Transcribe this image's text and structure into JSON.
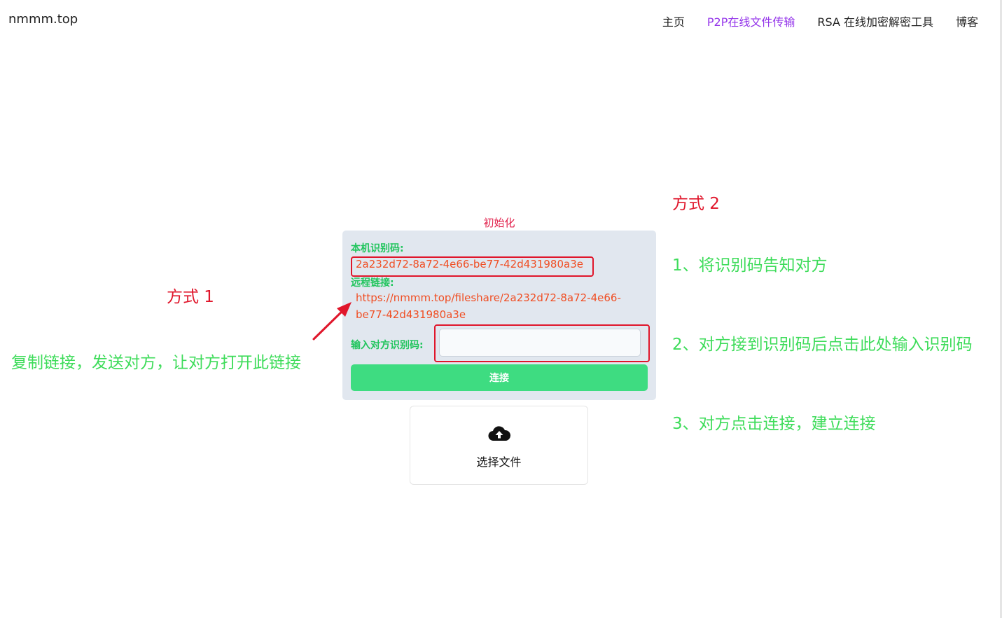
{
  "nav": {
    "brand": "nmmm.top",
    "links": [
      "主页",
      "P2P在线文件传输",
      "RSA 在线加密解密工具",
      "博客"
    ]
  },
  "status": "初始化",
  "card": {
    "local_id_label": "本机识别码:",
    "local_id_value": "2a232d72-8a72-4e66-be77-42d431980a3e",
    "remote_link_label": "远程链接:",
    "remote_link_value": "https://nmmm.top/fileshare/2a232d72-8a72-4e66-be77-42d431980a3e",
    "peer_input_label": "输入对方识别码:",
    "peer_input_value": "",
    "connect_label": "连接"
  },
  "uploader": {
    "label": "选择文件",
    "icon": "cloud-upload-icon"
  },
  "annotations": {
    "method1_title": "方式 1",
    "method1_desc": "复制链接，发送对方，让对方打开此链接",
    "method2_title": "方式 2",
    "step1": "1、将识别码告知对方",
    "step2": "2、对方接到识别码后点击此处输入识别码",
    "step3": "3、对方点击连接，建立连接"
  },
  "colors": {
    "nav_active": "#9333ea",
    "label_green": "#22c55e",
    "value_orange": "#f04e23",
    "button_green": "#3edc81",
    "annotation_red": "#e0162b",
    "annotation_green": "#3edc5a"
  }
}
